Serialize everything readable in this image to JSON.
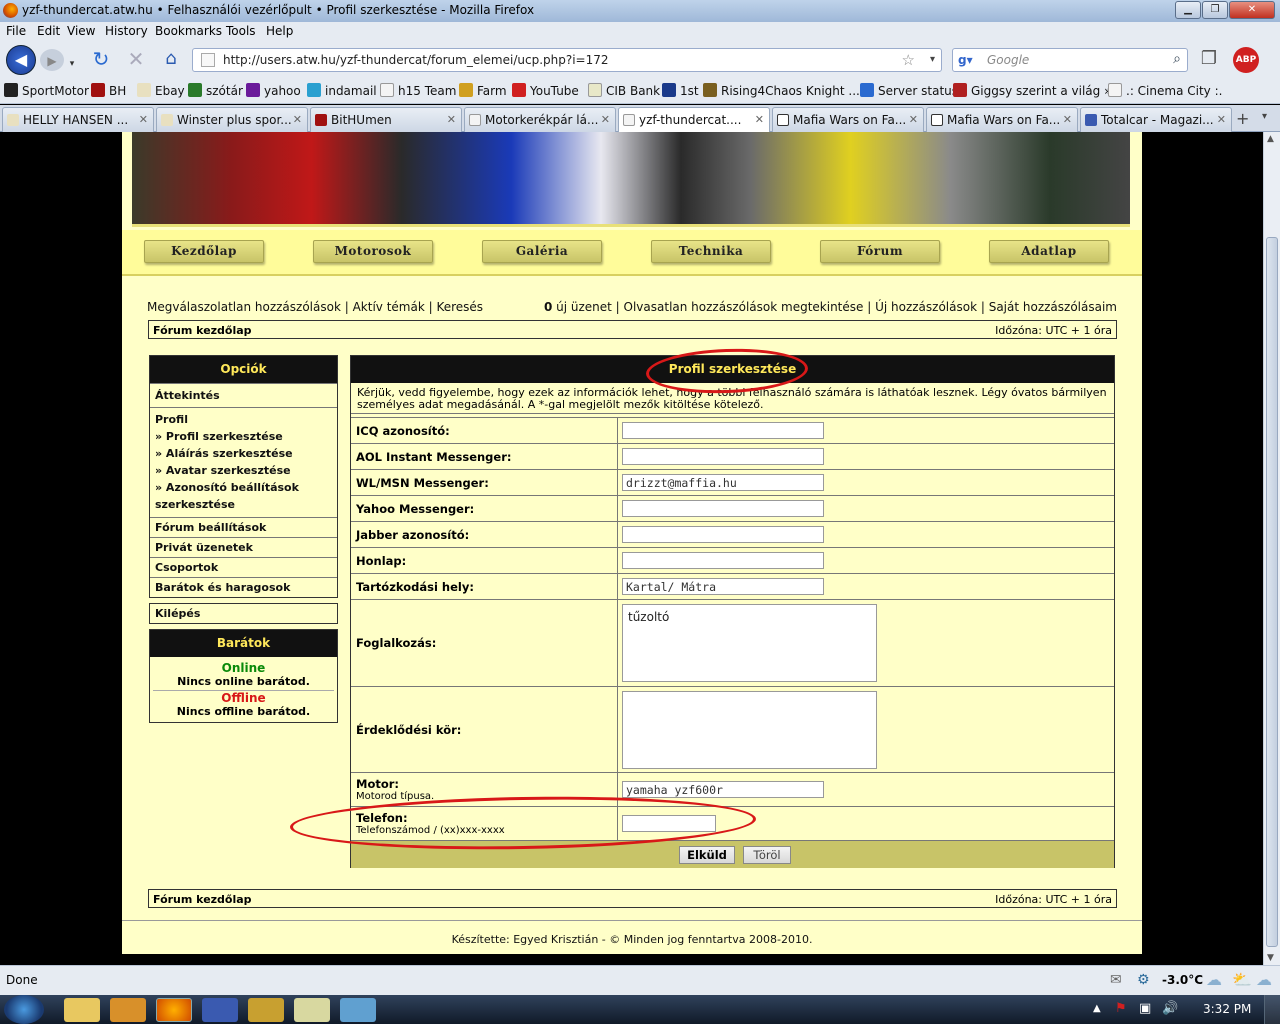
{
  "window": {
    "title": "yzf-thundercat.atw.hu • Felhasználói vezérlőpult • Profil szerkesztése - Mozilla Firefox"
  },
  "menu": [
    "File",
    "Edit",
    "View",
    "History",
    "Bookmarks",
    "Tools",
    "Help"
  ],
  "nav": {
    "url": "http://users.atw.hu/yzf-thundercat/forum_elemei/ucp.php?i=172",
    "search_placeholder": "Google"
  },
  "bookmarks": [
    "SportMotor",
    "BH",
    "Ebay",
    "szótár",
    "yahoo",
    "indamail",
    "h15 Team",
    "Farm",
    "YouTube",
    "CIB Bank",
    "1st",
    "Rising4Chaos Knight ...",
    "Server status",
    "Giggsy szerint a világ »...",
    ".: Cinema City :."
  ],
  "tabs": [
    "HELLY HANSEN ...",
    "Winster plus spor...",
    "BitHUmen",
    "Motorkerékpár lá...",
    "yzf-thundercat....",
    "Mafia Wars on Fa...",
    "Mafia Wars on Fa...",
    "Totalcar - Magazi..."
  ],
  "site_nav": [
    "Kezdőlap",
    "Motorosok",
    "Galéria",
    "Technika",
    "Fórum",
    "Adatlap"
  ],
  "toplinks": {
    "left": "Megválaszolatlan hozzászólások | Aktív témák | Keresés",
    "right_count": "0",
    "right": "új üzenet | Olvasatlan hozzászólások megtekintése | Új hozzászólások | Saját hozzászólásaim"
  },
  "crumb": {
    "left": "Fórum kezdőlap",
    "right": "Időzóna: UTC + 1 óra"
  },
  "options": {
    "title": "Opciók",
    "overview": "Áttekintés",
    "profile": "Profil",
    "profile_items": [
      "» Profil szerkesztése",
      "» Aláírás szerkesztése",
      "» Avatar szerkesztése",
      "» Azonosító beállítások szerkesztése"
    ],
    "others": [
      "Fórum beállítások",
      "Privát üzenetek",
      "Csoportok",
      "Barátok és haragosok"
    ],
    "logout": "Kilépés"
  },
  "friends": {
    "title": "Barátok",
    "online": "Online",
    "online_none": "Nincs online barátod.",
    "offline": "Offline",
    "offline_none": "Nincs offline barátod."
  },
  "form": {
    "title": "Profil szerkesztése",
    "note": "Kérjük, vedd figyelembe, hogy ezek az információk lehet, hogy a többi felhasználó számára is láthatóak lesznek. Légy óvatos bármilyen személyes adat megadásánál. A *-gal megjelölt mezők kitöltése kötelező.",
    "fields": [
      {
        "label": "ICQ azonosító:",
        "value": ""
      },
      {
        "label": "AOL Instant Messenger:",
        "value": ""
      },
      {
        "label": "WL/MSN Messenger:",
        "value": "drizzt@maffia.hu"
      },
      {
        "label": "Yahoo Messenger:",
        "value": ""
      },
      {
        "label": "Jabber azonosító:",
        "value": ""
      },
      {
        "label": "Honlap:",
        "value": ""
      },
      {
        "label": "Tartózkodási hely:",
        "value": "Kartal/ Mátra"
      }
    ],
    "occupation": {
      "label": "Foglalkozás:",
      "value": "tűzoltó"
    },
    "interests": {
      "label": "Érdeklődési kör:",
      "value": ""
    },
    "motor": {
      "label": "Motor:",
      "sub": "Motorod típusa.",
      "value": "yamaha yzf600r"
    },
    "phone": {
      "label": "Telefon:",
      "sub": "Telefonszámod / (xx)xxx-xxxx",
      "value": ""
    },
    "submit": "Elküld",
    "reset": "Töröl"
  },
  "footer": "Készítette: Egyed Krisztián - © Minden jog fenntartva 2008-2010.",
  "status": {
    "text": "Done",
    "temp": "-3.0°C"
  },
  "clock": "3:32 PM",
  "colors": {
    "page_bg": "#ffffc8",
    "header_bg": "#111111",
    "header_text": "#ffe85a",
    "highlight": "#d81818",
    "online": "#0a8a0a",
    "offline": "#d81818"
  }
}
